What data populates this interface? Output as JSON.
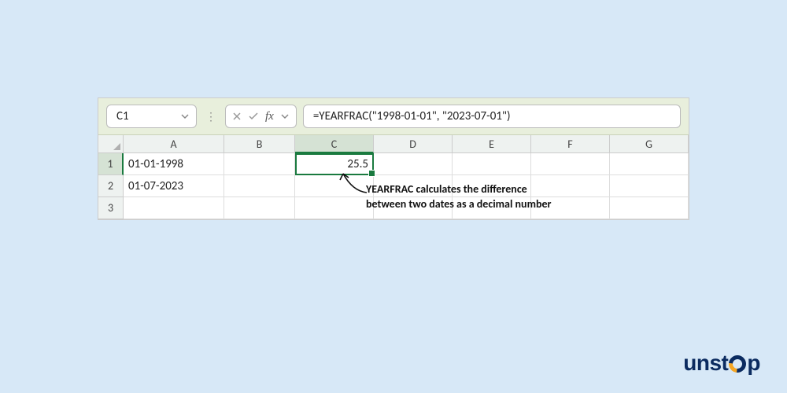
{
  "formula_bar": {
    "cell_ref": "C1",
    "fx_label": "fx",
    "formula": "=YEARFRAC(\"1998-01-01\", \"2023-07-01\")"
  },
  "columns": [
    "A",
    "B",
    "C",
    "D",
    "E",
    "F",
    "G"
  ],
  "selected_column_index": 2,
  "rows": [
    {
      "num": "1",
      "A": "01-01-1998",
      "C": "25.5"
    },
    {
      "num": "2",
      "A": "01-07-2023"
    },
    {
      "num": "3"
    }
  ],
  "selected_row_index": 0,
  "selected_cell": "C1",
  "annotation": {
    "text_line1": "YEARFRAC calculates the difference",
    "text_line2": "between two dates as a decimal number"
  },
  "brand": {
    "prefix": "unst",
    "suffix": "p"
  }
}
